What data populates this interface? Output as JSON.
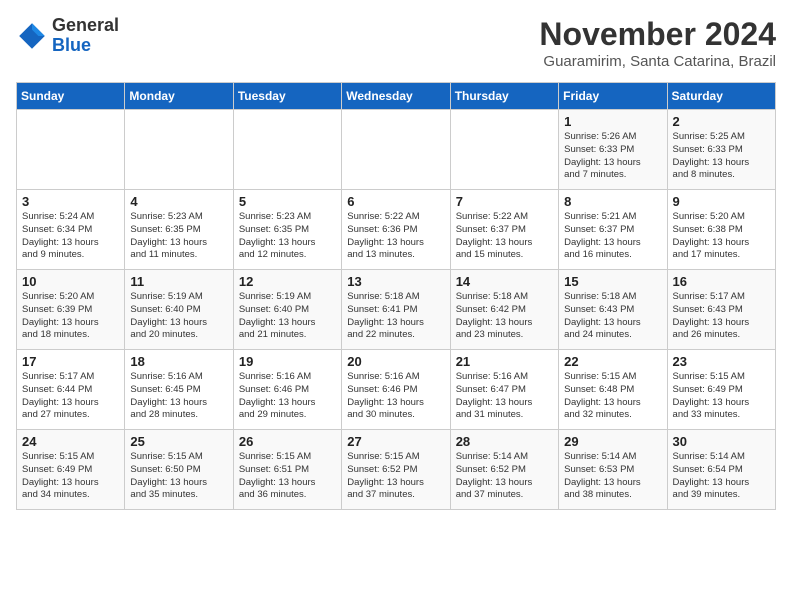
{
  "header": {
    "logo_general": "General",
    "logo_blue": "Blue",
    "month": "November 2024",
    "location": "Guaramirim, Santa Catarina, Brazil"
  },
  "days_of_week": [
    "Sunday",
    "Monday",
    "Tuesday",
    "Wednesday",
    "Thursday",
    "Friday",
    "Saturday"
  ],
  "weeks": [
    [
      {
        "day": "",
        "info": ""
      },
      {
        "day": "",
        "info": ""
      },
      {
        "day": "",
        "info": ""
      },
      {
        "day": "",
        "info": ""
      },
      {
        "day": "",
        "info": ""
      },
      {
        "day": "1",
        "info": "Sunrise: 5:26 AM\nSunset: 6:33 PM\nDaylight: 13 hours\nand 7 minutes."
      },
      {
        "day": "2",
        "info": "Sunrise: 5:25 AM\nSunset: 6:33 PM\nDaylight: 13 hours\nand 8 minutes."
      }
    ],
    [
      {
        "day": "3",
        "info": "Sunrise: 5:24 AM\nSunset: 6:34 PM\nDaylight: 13 hours\nand 9 minutes."
      },
      {
        "day": "4",
        "info": "Sunrise: 5:23 AM\nSunset: 6:35 PM\nDaylight: 13 hours\nand 11 minutes."
      },
      {
        "day": "5",
        "info": "Sunrise: 5:23 AM\nSunset: 6:35 PM\nDaylight: 13 hours\nand 12 minutes."
      },
      {
        "day": "6",
        "info": "Sunrise: 5:22 AM\nSunset: 6:36 PM\nDaylight: 13 hours\nand 13 minutes."
      },
      {
        "day": "7",
        "info": "Sunrise: 5:22 AM\nSunset: 6:37 PM\nDaylight: 13 hours\nand 15 minutes."
      },
      {
        "day": "8",
        "info": "Sunrise: 5:21 AM\nSunset: 6:37 PM\nDaylight: 13 hours\nand 16 minutes."
      },
      {
        "day": "9",
        "info": "Sunrise: 5:20 AM\nSunset: 6:38 PM\nDaylight: 13 hours\nand 17 minutes."
      }
    ],
    [
      {
        "day": "10",
        "info": "Sunrise: 5:20 AM\nSunset: 6:39 PM\nDaylight: 13 hours\nand 18 minutes."
      },
      {
        "day": "11",
        "info": "Sunrise: 5:19 AM\nSunset: 6:40 PM\nDaylight: 13 hours\nand 20 minutes."
      },
      {
        "day": "12",
        "info": "Sunrise: 5:19 AM\nSunset: 6:40 PM\nDaylight: 13 hours\nand 21 minutes."
      },
      {
        "day": "13",
        "info": "Sunrise: 5:18 AM\nSunset: 6:41 PM\nDaylight: 13 hours\nand 22 minutes."
      },
      {
        "day": "14",
        "info": "Sunrise: 5:18 AM\nSunset: 6:42 PM\nDaylight: 13 hours\nand 23 minutes."
      },
      {
        "day": "15",
        "info": "Sunrise: 5:18 AM\nSunset: 6:43 PM\nDaylight: 13 hours\nand 24 minutes."
      },
      {
        "day": "16",
        "info": "Sunrise: 5:17 AM\nSunset: 6:43 PM\nDaylight: 13 hours\nand 26 minutes."
      }
    ],
    [
      {
        "day": "17",
        "info": "Sunrise: 5:17 AM\nSunset: 6:44 PM\nDaylight: 13 hours\nand 27 minutes."
      },
      {
        "day": "18",
        "info": "Sunrise: 5:16 AM\nSunset: 6:45 PM\nDaylight: 13 hours\nand 28 minutes."
      },
      {
        "day": "19",
        "info": "Sunrise: 5:16 AM\nSunset: 6:46 PM\nDaylight: 13 hours\nand 29 minutes."
      },
      {
        "day": "20",
        "info": "Sunrise: 5:16 AM\nSunset: 6:46 PM\nDaylight: 13 hours\nand 30 minutes."
      },
      {
        "day": "21",
        "info": "Sunrise: 5:16 AM\nSunset: 6:47 PM\nDaylight: 13 hours\nand 31 minutes."
      },
      {
        "day": "22",
        "info": "Sunrise: 5:15 AM\nSunset: 6:48 PM\nDaylight: 13 hours\nand 32 minutes."
      },
      {
        "day": "23",
        "info": "Sunrise: 5:15 AM\nSunset: 6:49 PM\nDaylight: 13 hours\nand 33 minutes."
      }
    ],
    [
      {
        "day": "24",
        "info": "Sunrise: 5:15 AM\nSunset: 6:49 PM\nDaylight: 13 hours\nand 34 minutes."
      },
      {
        "day": "25",
        "info": "Sunrise: 5:15 AM\nSunset: 6:50 PM\nDaylight: 13 hours\nand 35 minutes."
      },
      {
        "day": "26",
        "info": "Sunrise: 5:15 AM\nSunset: 6:51 PM\nDaylight: 13 hours\nand 36 minutes."
      },
      {
        "day": "27",
        "info": "Sunrise: 5:15 AM\nSunset: 6:52 PM\nDaylight: 13 hours\nand 37 minutes."
      },
      {
        "day": "28",
        "info": "Sunrise: 5:14 AM\nSunset: 6:52 PM\nDaylight: 13 hours\nand 37 minutes."
      },
      {
        "day": "29",
        "info": "Sunrise: 5:14 AM\nSunset: 6:53 PM\nDaylight: 13 hours\nand 38 minutes."
      },
      {
        "day": "30",
        "info": "Sunrise: 5:14 AM\nSunset: 6:54 PM\nDaylight: 13 hours\nand 39 minutes."
      }
    ]
  ]
}
